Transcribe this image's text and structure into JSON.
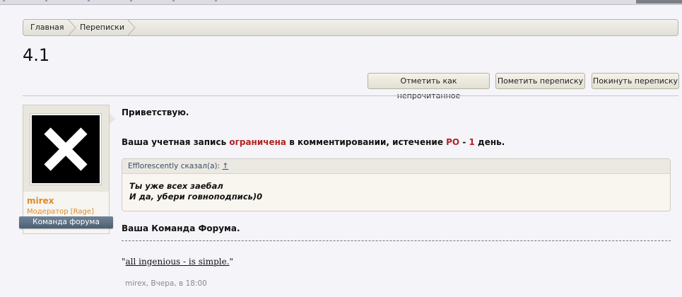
{
  "breadcrumb": {
    "home": "Главная",
    "pm": "Переписки"
  },
  "page": {
    "title": "4.1"
  },
  "toolbar": {
    "mark_unread": "Отметить как непрочитанное",
    "mark_conversation": "Пометить переписку",
    "leave_conversation": "Покинуть переписку"
  },
  "user": {
    "name": "mirex",
    "role": "Модератор [Rage]",
    "ribbon": "Команда форума"
  },
  "message": {
    "greeting": "Приветствую.",
    "line2_a": "Ваша учетная запись ",
    "line2_b": "ограничена",
    "line2_c": " в комментировании, истечение ",
    "line2_d": "РО",
    "line2_e": " - ",
    "line2_f": "1",
    "line2_g": " день.",
    "quote_author": "Efflorescently сказал(а):",
    "quote_uplink": "↑",
    "quote_line1": "Ты уже всех заебал",
    "quote_line2": "И да, убери говноподпись)0",
    "signoff": "Ваша Команда Форума."
  },
  "signature": {
    "open": "\"",
    "link": "all ingenious - is simple.",
    "close": "\""
  },
  "meta": {
    "text": "mirex, Вчера, в 18:00"
  },
  "colors": {
    "accent_red": "#b22222",
    "username": "#e08a24",
    "ribbon": "#5a6e82"
  }
}
